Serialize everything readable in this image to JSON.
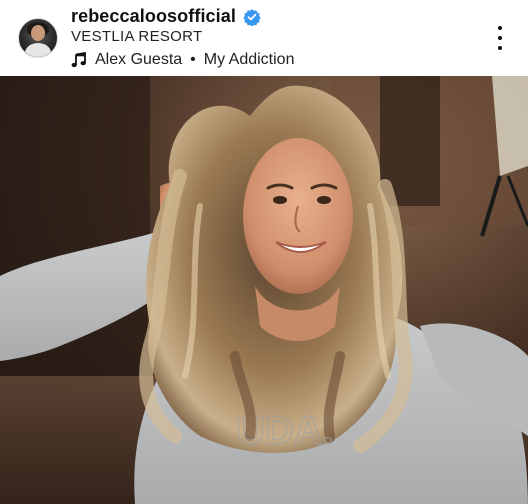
{
  "post": {
    "username": "rebeccaloosofficial",
    "location": "VESTLIA RESORT",
    "music": {
      "artist": "Alex Guesta",
      "separator": "•",
      "track": "My Addiction"
    }
  },
  "icons": {
    "verified": "verified-badge-icon",
    "music": "music-note-icon",
    "more": "more-options-icon"
  },
  "colors": {
    "verified_blue": "#3897f0",
    "text": "#111111"
  }
}
